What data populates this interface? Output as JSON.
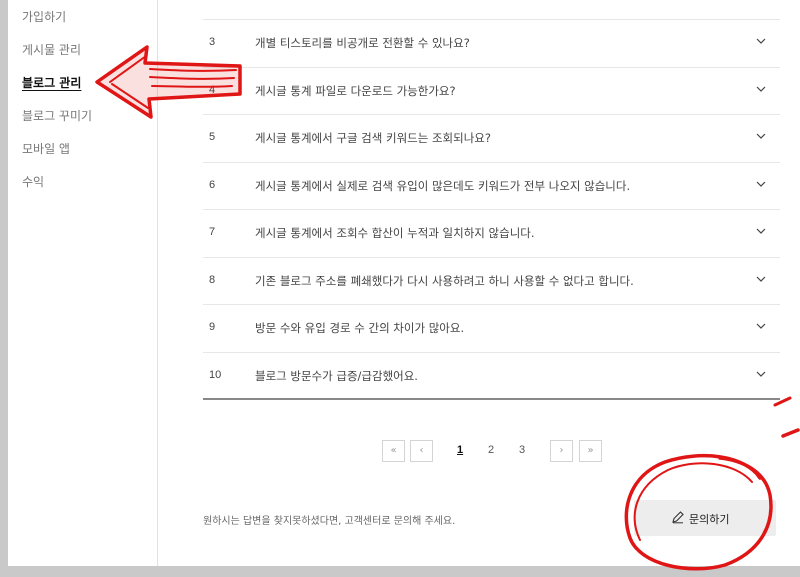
{
  "sidebar": {
    "items": [
      {
        "label": "가입하기"
      },
      {
        "label": "게시물 관리"
      },
      {
        "label": "블로그 관리"
      },
      {
        "label": "블로그 꾸미기"
      },
      {
        "label": "모바일 앱"
      },
      {
        "label": "수익"
      }
    ],
    "active_index": 2
  },
  "faq": {
    "rows": [
      {
        "num": "3",
        "question": "개별 티스토리를 비공개로 전환할 수 있나요?"
      },
      {
        "num": "4",
        "question": "게시글 통계 파일로 다운로드 가능한가요?"
      },
      {
        "num": "5",
        "question": "게시글 통계에서 구글 검색 키워드는 조회되나요?"
      },
      {
        "num": "6",
        "question": "게시글 통계에서 실제로 검색 유입이 많은데도 키워드가 전부 나오지 않습니다."
      },
      {
        "num": "7",
        "question": "게시글 통계에서 조회수 합산이 누적과 일치하지 않습니다."
      },
      {
        "num": "8",
        "question": "기존 블로그 주소를 폐쇄했다가 다시 사용하려고 하니 사용할 수 없다고 합니다."
      },
      {
        "num": "9",
        "question": "방문 수와 유입 경로 수 간의 차이가 많아요."
      },
      {
        "num": "10",
        "question": "블로그 방문수가 급증/급감했어요."
      }
    ]
  },
  "pagination": {
    "first": "«",
    "prev": "‹",
    "pages": [
      "1",
      "2",
      "3"
    ],
    "current": "1",
    "next": "›",
    "last": "»"
  },
  "footer": {
    "help_text": "원하시는 답변을 찾지못하셨다면, 고객센터로 문의해 주세요.",
    "ask_button": "문의하기",
    "ask_icon": "pencil-icon"
  },
  "annotations": {
    "arrow_color": "#e01515",
    "circle_color": "#e01515"
  }
}
